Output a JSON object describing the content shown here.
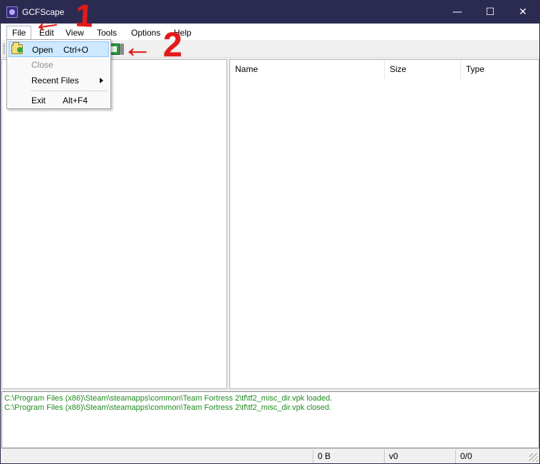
{
  "window": {
    "title": "GCFScape",
    "controls": {
      "minimize": "—",
      "maximize": "☐",
      "close": "✕"
    }
  },
  "menu": {
    "items": [
      "File",
      "Edit",
      "View",
      "Tools",
      "Options",
      "Help"
    ]
  },
  "file_menu": {
    "items": [
      {
        "label": "Open",
        "shortcut": "Ctrl+O",
        "icon": "folder-open-icon"
      },
      {
        "label": "Close",
        "shortcut": ""
      },
      {
        "label": "Recent Files",
        "shortcut": ""
      },
      {
        "label": "Exit",
        "shortcut": "Alt+F4"
      }
    ],
    "submenu_indicator": "triangle-right-icon"
  },
  "file_list": {
    "columns": [
      "Name",
      "Size",
      "Type"
    ]
  },
  "log": {
    "lines": [
      "C:\\Program Files (x86)\\Steam\\steamapps\\common\\Team Fortress 2\\tf\\tf2_misc_dir.vpk loaded.",
      "C:\\Program Files (x86)\\Steam\\steamapps\\common\\Team Fortress 2\\tf\\tf2_misc_dir.vpk closed."
    ]
  },
  "status": {
    "size": "0 B",
    "version": "v0",
    "count": "0/0"
  },
  "annotations": {
    "marker_1": "1",
    "marker_2": "2",
    "arrow": "←",
    "color": "#e31a1a"
  },
  "colors": {
    "titlebar": "#2b2b52",
    "selection": "#cde8ff",
    "log_text": "#1f8b1f"
  }
}
